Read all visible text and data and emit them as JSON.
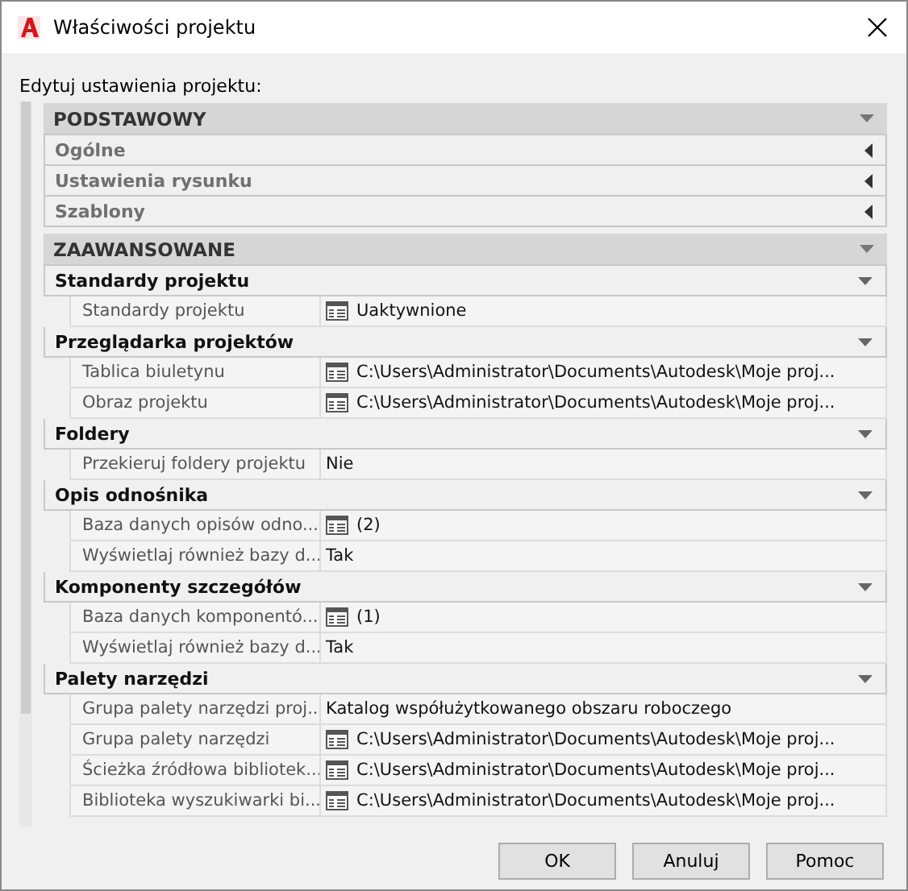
{
  "window": {
    "title": "Właściwości projektu"
  },
  "prompt": "Edytuj ustawienia projektu:",
  "categories": [
    {
      "title": "PODSTAWOWY",
      "expanded": true,
      "groups": [
        {
          "title": "Ogólne",
          "expanded": false
        },
        {
          "title": "Ustawienia rysunku",
          "expanded": false
        },
        {
          "title": "Szablony",
          "expanded": false
        }
      ]
    },
    {
      "title": "ZAAWANSOWANE",
      "expanded": true,
      "groups": [
        {
          "title": "Standardy projektu",
          "expanded": true,
          "rows": [
            {
              "label": "Standardy projektu",
              "value": "Uaktywnione",
              "kind": "list"
            }
          ]
        },
        {
          "title": "Przeglądarka projektów",
          "expanded": true,
          "rows": [
            {
              "label": "Tablica biuletynu",
              "value": "C:\\Users\\Administrator\\Documents\\Autodesk\\Moje  proj...",
              "kind": "list"
            },
            {
              "label": "Obraz projektu",
              "value": "C:\\Users\\Administrator\\Documents\\Autodesk\\Moje  proj...",
              "kind": "list"
            }
          ]
        },
        {
          "title": "Foldery",
          "expanded": true,
          "rows": [
            {
              "label": "Przekieruj foldery projektu",
              "value": "Nie",
              "kind": "text"
            }
          ]
        },
        {
          "title": "Opis odnośnika",
          "expanded": true,
          "rows": [
            {
              "label": "Baza danych opisów odno...",
              "value": "(2)",
              "kind": "list"
            },
            {
              "label": "Wyświetlaj również bazy d...",
              "value": "Tak",
              "kind": "text"
            }
          ]
        },
        {
          "title": "Komponenty szczegółów",
          "expanded": true,
          "rows": [
            {
              "label": "Baza danych komponentó...",
              "value": "(1)",
              "kind": "list"
            },
            {
              "label": "Wyświetlaj również bazy d...",
              "value": "Tak",
              "kind": "text"
            }
          ]
        },
        {
          "title": "Palety narzędzi",
          "expanded": true,
          "rows": [
            {
              "label": "Grupa palety narzędzi proj...",
              "value": "Katalog współużytkowanego obszaru roboczego",
              "kind": "text"
            },
            {
              "label": "Grupa palety narzędzi",
              "value": "C:\\Users\\Administrator\\Documents\\Autodesk\\Moje  proj...",
              "kind": "list"
            },
            {
              "label": "Ścieżka źródłowa bibliotek...",
              "value": "C:\\Users\\Administrator\\Documents\\Autodesk\\Moje  proj...",
              "kind": "list"
            },
            {
              "label": "Biblioteka wyszukiwarki bi...",
              "value": "C:\\Users\\Administrator\\Documents\\Autodesk\\Moje  proj...",
              "kind": "list"
            }
          ]
        }
      ]
    }
  ],
  "buttons": [
    "OK",
    "Anuluj",
    "Pomoc"
  ]
}
